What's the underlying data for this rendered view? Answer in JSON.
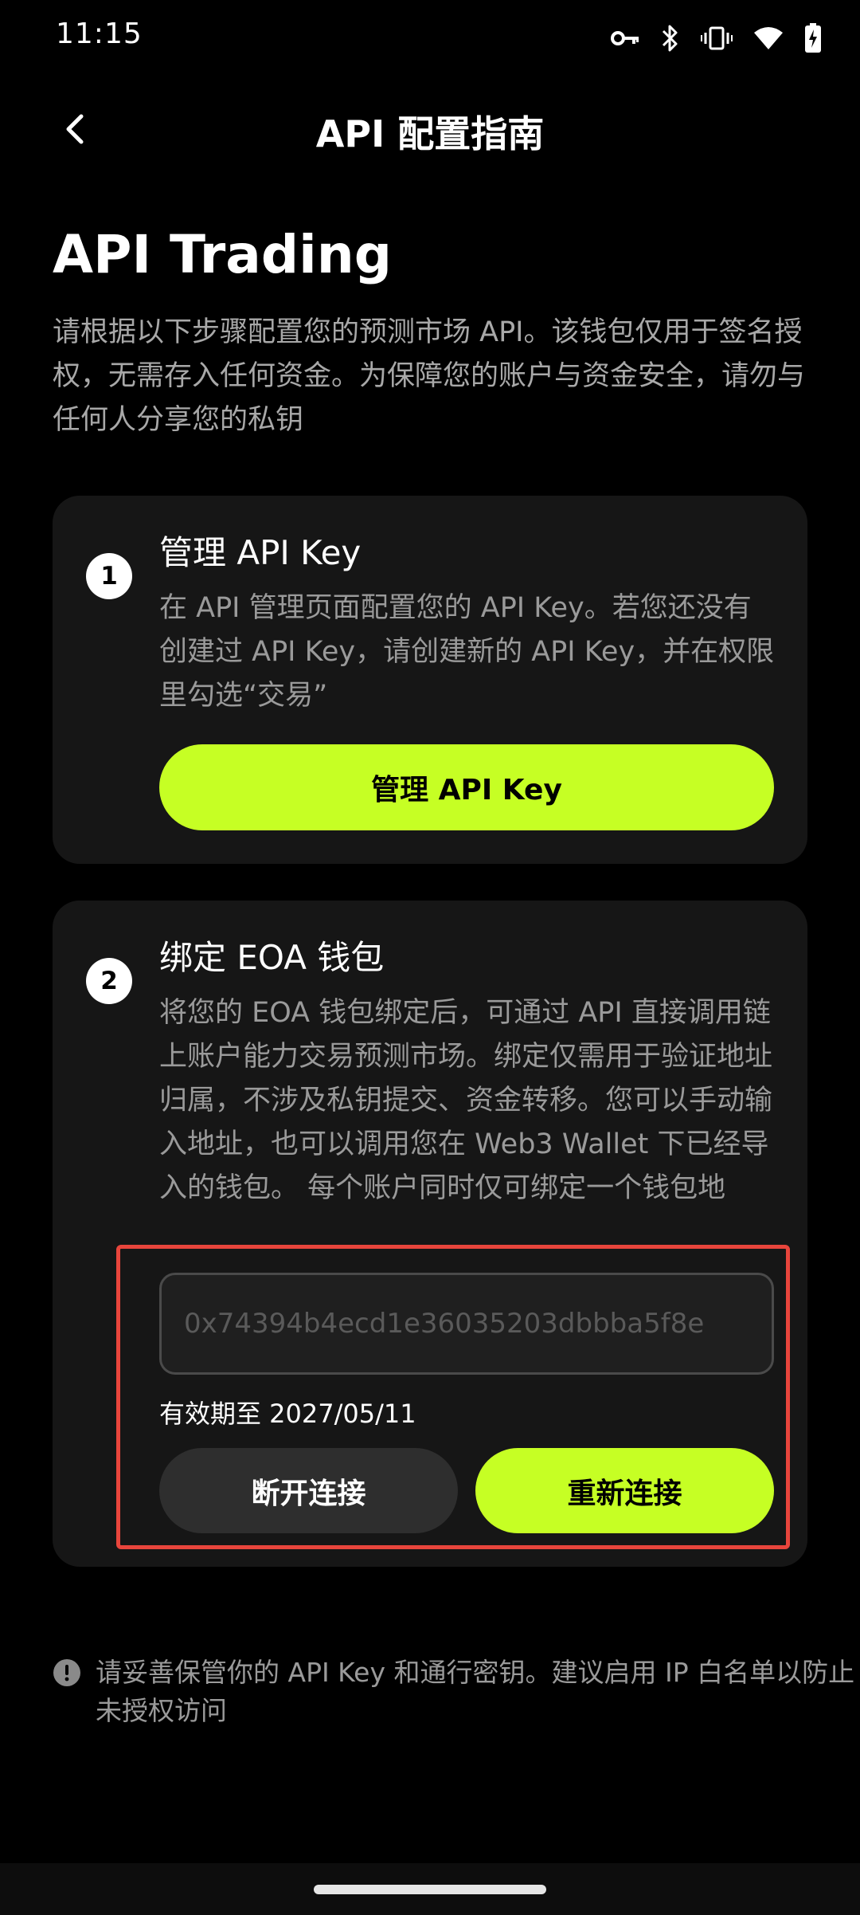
{
  "status_bar": {
    "time": "11:15",
    "icons": [
      "vpn-key-icon",
      "bluetooth-icon",
      "vibrate-icon",
      "wifi-icon",
      "battery-charging-icon"
    ]
  },
  "nav": {
    "title": "API 配置指南",
    "back_icon": "chevron-left-icon"
  },
  "page": {
    "heading": "API Trading",
    "description": "请根据以下步骤配置您的预测市场 API。该钱包仅用于签名授权，无需存入任何资金。为保障您的账户与资金安全，请勿与任何人分享您的私钥"
  },
  "step1": {
    "number": "1",
    "title": "管理 API Key",
    "description": "在 API 管理页面配置您的 API Key。若您还没有创建过 API Key，请创建新的 API Key，并在权限里勾选“交易”",
    "button_label": "管理 API Key"
  },
  "step2": {
    "number": "2",
    "title": "绑定 EOA 钱包",
    "description": "将您的 EOA 钱包绑定后，可通过 API 直接调用链上账户能力交易预测市场。绑定仅需用于验证地址归属，不涉及私钥提交、资金转移。您可以手动输入地址，也可以调用您在 Web3 Wallet 下已经导入的钱包。 每个账户同时仅可绑定一个钱包地址。",
    "address": "0x74394b4ecd1e36035203dbbba5f8e",
    "validity": "有效期至 2027/05/11",
    "disconnect_label": "断开连接",
    "reconnect_label": "重新连接"
  },
  "footer": {
    "icon": "info-icon",
    "note": "请妥善保管你的 API Key 和通行密钥。建议启用 IP 白名单以防止未授权访问"
  },
  "colors": {
    "background": "#000000",
    "card": "#161616",
    "accent": "#c6ff24",
    "highlight_border": "#e8453c",
    "muted_text": "#9a9a9a"
  }
}
